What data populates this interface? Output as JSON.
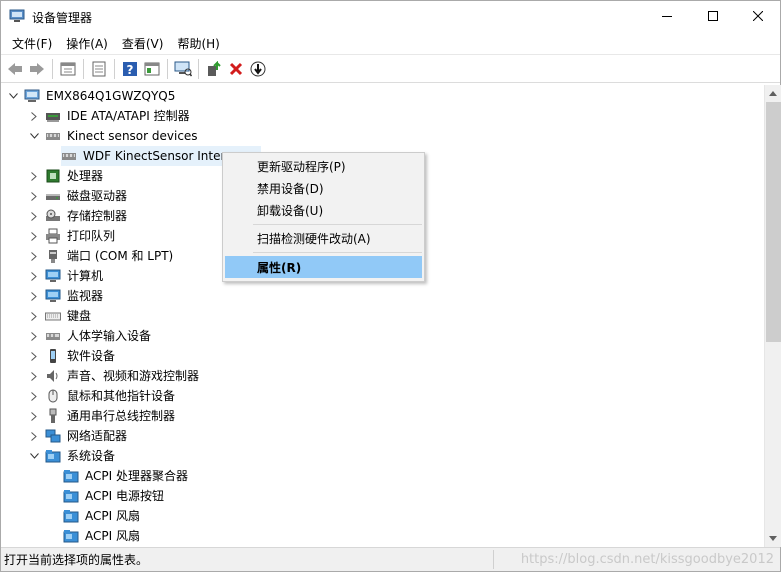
{
  "window": {
    "title": "设备管理器",
    "icon": "device-manager-icon"
  },
  "menu": [
    "文件(F)",
    "操作(A)",
    "查看(V)",
    "帮助(H)"
  ],
  "toolbar": [
    "back-icon",
    "forward-icon",
    "show-hide-icon",
    "properties-icon",
    "help-icon",
    "view-icon",
    "scan-icon",
    "update-driver-icon",
    "uninstall-icon",
    "disable-icon"
  ],
  "tree": {
    "root": "EMX864Q1GWZQYQ5",
    "items": [
      {
        "label": "IDE ATA/ATAPI 控制器",
        "icon": "ide-controller-icon",
        "expanded": false
      },
      {
        "label": "Kinect sensor devices",
        "icon": "kinect-icon",
        "expanded": true
      },
      {
        "label": "WDF KinectSensor Inter",
        "icon": "kinect-device-icon",
        "child": true
      },
      {
        "label": "处理器",
        "icon": "cpu-icon",
        "expanded": false
      },
      {
        "label": "磁盘驱动器",
        "icon": "disk-icon",
        "expanded": false
      },
      {
        "label": "存储控制器",
        "icon": "storage-icon",
        "expanded": false
      },
      {
        "label": "打印队列",
        "icon": "printer-icon",
        "expanded": false
      },
      {
        "label": "端口 (COM 和 LPT)",
        "icon": "port-icon",
        "expanded": false
      },
      {
        "label": "计算机",
        "icon": "computer-icon",
        "expanded": false
      },
      {
        "label": "监视器",
        "icon": "monitor-icon",
        "expanded": false
      },
      {
        "label": "键盘",
        "icon": "keyboard-icon",
        "expanded": false
      },
      {
        "label": "人体学输入设备",
        "icon": "hid-icon",
        "expanded": false
      },
      {
        "label": "软件设备",
        "icon": "software-device-icon",
        "expanded": false
      },
      {
        "label": "声音、视频和游戏控制器",
        "icon": "sound-icon",
        "expanded": false
      },
      {
        "label": "鼠标和其他指针设备",
        "icon": "mouse-icon",
        "expanded": false
      },
      {
        "label": "通用串行总线控制器",
        "icon": "usb-icon",
        "expanded": false
      },
      {
        "label": "网络适配器",
        "icon": "network-icon",
        "expanded": false
      },
      {
        "label": "系统设备",
        "icon": "system-device-icon",
        "expanded": true
      },
      {
        "label": "ACPI 处理器聚合器",
        "icon": "system-folder-icon",
        "child": true
      },
      {
        "label": "ACPI 电源按钮",
        "icon": "system-folder-icon",
        "child": true
      },
      {
        "label": "ACPI 风扇",
        "icon": "system-folder-icon",
        "child": true
      },
      {
        "label": "ACPI 风扇",
        "icon": "system-folder-icon",
        "child": true
      }
    ]
  },
  "context_menu": {
    "items": [
      {
        "label": "更新驱动程序(P)",
        "bold": false
      },
      {
        "label": "禁用设备(D)",
        "bold": false
      },
      {
        "label": "卸载设备(U)",
        "bold": false
      },
      {
        "label": "扫描检测硬件改动(A)",
        "bold": false
      },
      {
        "label": "属性(R)",
        "bold": true,
        "highlighted": true
      }
    ]
  },
  "status": {
    "text": "打开当前选择项的属性表。",
    "watermark": "https://blog.csdn.net/kissgoodbye2012"
  },
  "colors": {
    "highlight": "#91c9f7",
    "selection": "#e5f1fb",
    "menu_bg": "#f2f2f2"
  }
}
